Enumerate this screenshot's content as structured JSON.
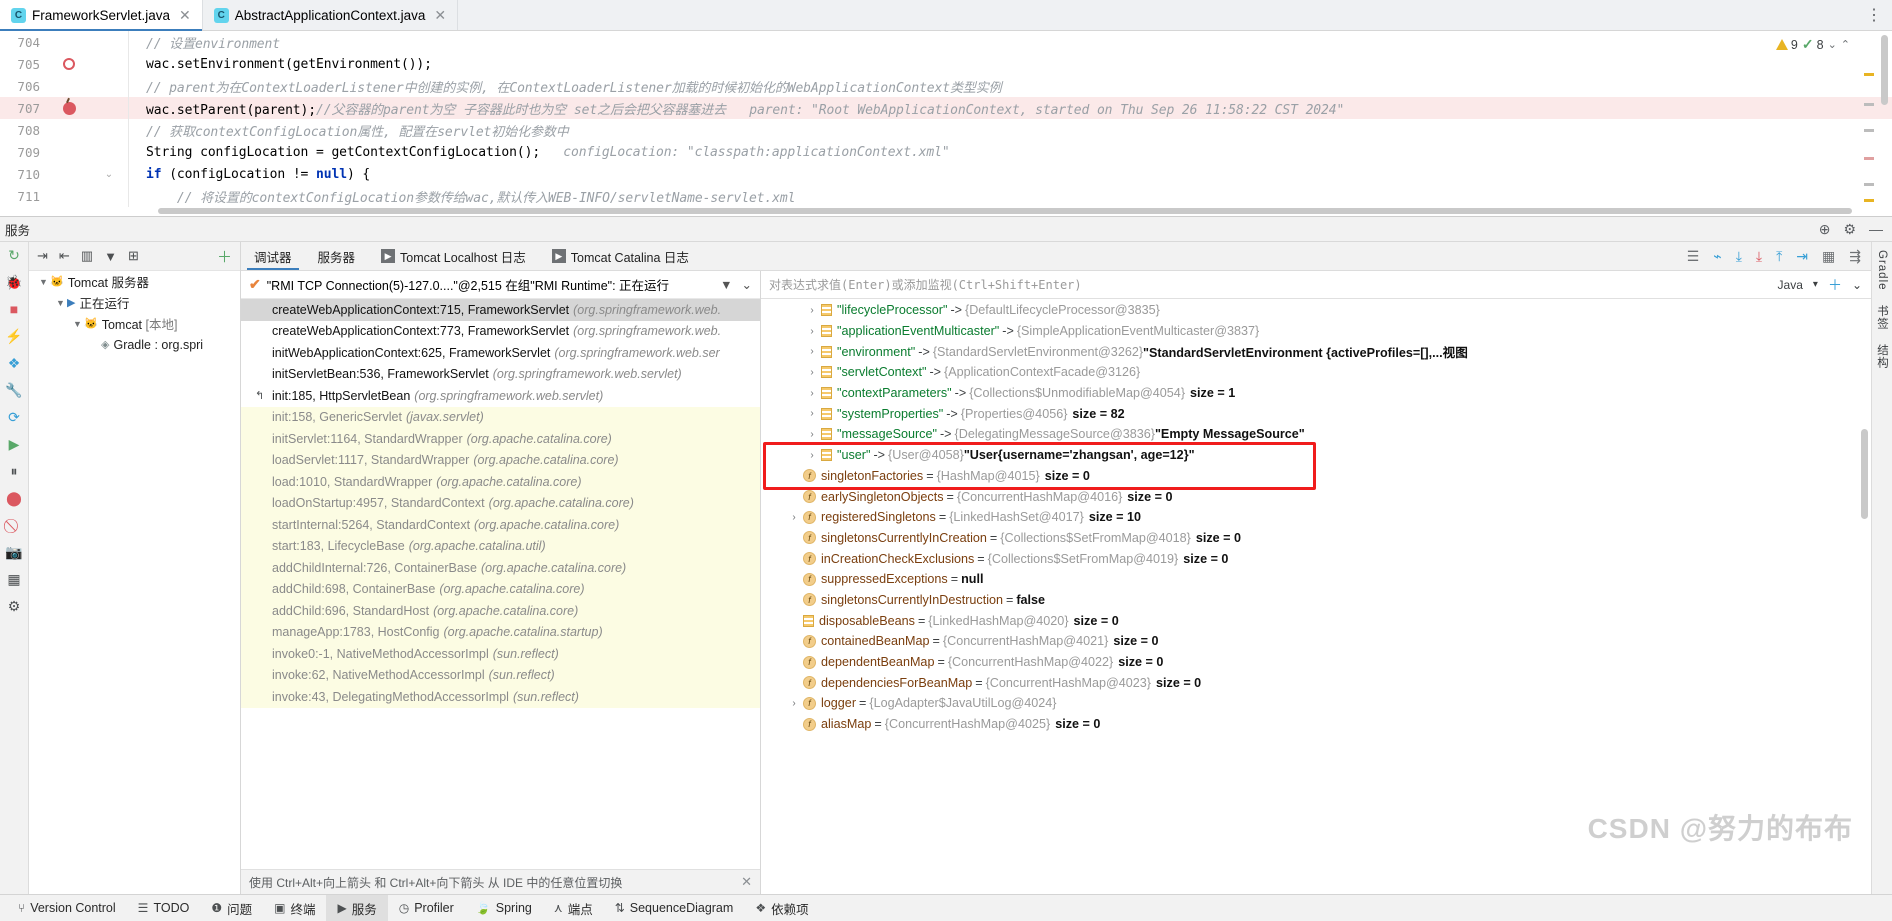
{
  "editor_tabs": [
    {
      "label": "FrameworkServlet.java",
      "icon": "java-class-icon",
      "active": true,
      "closable": true
    },
    {
      "label": "AbstractApplicationContext.java",
      "icon": "java-class-icon",
      "active": false,
      "closable": true
    }
  ],
  "editor": {
    "warnings_count": "9",
    "hints_count": "8",
    "lines": [
      {
        "num": "704",
        "marker": "",
        "fold": "",
        "highlight": false,
        "segments": [
          {
            "cls": "cm",
            "t": "// 设置environment"
          }
        ]
      },
      {
        "num": "705",
        "marker": "breakpoint-ring",
        "fold": "",
        "highlight": false,
        "segments": [
          {
            "cls": "cid",
            "t": "wac.setEnvironment(getEnvironment());"
          }
        ]
      },
      {
        "num": "706",
        "marker": "",
        "fold": "",
        "highlight": false,
        "segments": [
          {
            "cls": "cm",
            "t": "// parent为在ContextLoaderListener中创建的实例, 在ContextLoaderListener加载的时候初始化的WebApplicationContext类型实例"
          }
        ]
      },
      {
        "num": "707",
        "marker": "breakpoint-hit",
        "fold": "",
        "highlight": true,
        "segments": [
          {
            "cls": "cid",
            "t": "wac.setParent(parent);"
          },
          {
            "cls": "cm",
            "t": "//父容器的parent为空 子容器此时也为空 set之后会把父容器塞进去"
          },
          {
            "cls": "chint",
            "t": "   parent: \"Root WebApplicationContext, started on Thu Sep 26 11:58:22 CST 2024\""
          }
        ]
      },
      {
        "num": "708",
        "marker": "",
        "fold": "",
        "highlight": false,
        "segments": [
          {
            "cls": "cm",
            "t": "// 获取contextConfigLocation属性, 配置在servlet初始化参数中"
          }
        ]
      },
      {
        "num": "709",
        "marker": "",
        "fold": "",
        "highlight": false,
        "segments": [
          {
            "cls": "cid",
            "t": "String configLocation = getContextConfigLocation();"
          },
          {
            "cls": "chint",
            "t": "   configLocation: \"classpath:applicationContext.xml\""
          }
        ]
      },
      {
        "num": "710",
        "marker": "",
        "fold": "fold-collapse",
        "highlight": false,
        "segments": [
          {
            "cls": "ckw",
            "t": "if"
          },
          {
            "cls": "cid",
            "t": " (configLocation != "
          },
          {
            "cls": "ckw",
            "t": "null"
          },
          {
            "cls": "cid",
            "t": ") {"
          }
        ]
      },
      {
        "num": "711",
        "marker": "",
        "fold": "",
        "highlight": false,
        "segments": [
          {
            "cls": "cm",
            "t": "    // 将设置的contextConfigLocation参数传给wac,默认传入WEB-INFO/servletName-servlet.xml"
          }
        ]
      }
    ]
  },
  "services_panel": {
    "title": "服务"
  },
  "services_tree": {
    "nodes": [
      {
        "indent": 0,
        "twisty": "▼",
        "icon": "tomcat-icon",
        "label": "Tomcat 服务器",
        "suffix": ""
      },
      {
        "indent": 1,
        "twisty": "▼",
        "icon": "run-icon",
        "label": "正在运行",
        "suffix": ""
      },
      {
        "indent": 2,
        "twisty": "▼",
        "icon": "tomcat-icon",
        "label": "Tomcat",
        "suffix": " [本地]"
      },
      {
        "indent": 3,
        "twisty": "",
        "icon": "gradle-icon",
        "label": "Gradle : org.spri",
        "suffix": ""
      }
    ]
  },
  "debug_tabs": [
    {
      "label": "调试器",
      "icon": "",
      "active": true
    },
    {
      "label": "服务器",
      "icon": "",
      "active": false
    },
    {
      "label": "Tomcat Localhost 日志",
      "icon": "console-icon",
      "active": false
    },
    {
      "label": "Tomcat Catalina 日志",
      "icon": "console-icon",
      "active": false
    }
  ],
  "frames": {
    "thread_label": "\"RMI TCP Connection(5)-127.0....\"@2,515 在组\"RMI Runtime\": 正在运行",
    "footer_hint": "使用 Ctrl+Alt+向上箭头 和 Ctrl+Alt+向下箭头 从 IDE 中的任意位置切换",
    "rows": [
      {
        "method": "createWebApplicationContext:715, FrameworkServlet",
        "pkg": "(org.springframework.web.",
        "state": "selected",
        "mark": ""
      },
      {
        "method": "createWebApplicationContext:773, FrameworkServlet",
        "pkg": "(org.springframework.web.",
        "state": "normal",
        "mark": ""
      },
      {
        "method": "initWebApplicationContext:625, FrameworkServlet",
        "pkg": "(org.springframework.web.ser",
        "state": "normal",
        "mark": ""
      },
      {
        "method": "initServletBean:536, FrameworkServlet",
        "pkg": "(org.springframework.web.servlet)",
        "state": "normal",
        "mark": ""
      },
      {
        "method": "init:185, HttpServletBean",
        "pkg": "(org.springframework.web.servlet)",
        "state": "normal",
        "mark": "↰"
      },
      {
        "method": "init:158, GenericServlet",
        "pkg": "(javax.servlet)",
        "state": "library",
        "mark": ""
      },
      {
        "method": "initServlet:1164, StandardWrapper",
        "pkg": "(org.apache.catalina.core)",
        "state": "library",
        "mark": ""
      },
      {
        "method": "loadServlet:1117, StandardWrapper",
        "pkg": "(org.apache.catalina.core)",
        "state": "library",
        "mark": ""
      },
      {
        "method": "load:1010, StandardWrapper",
        "pkg": "(org.apache.catalina.core)",
        "state": "library",
        "mark": ""
      },
      {
        "method": "loadOnStartup:4957, StandardContext",
        "pkg": "(org.apache.catalina.core)",
        "state": "library",
        "mark": ""
      },
      {
        "method": "startInternal:5264, StandardContext",
        "pkg": "(org.apache.catalina.core)",
        "state": "library",
        "mark": ""
      },
      {
        "method": "start:183, LifecycleBase",
        "pkg": "(org.apache.catalina.util)",
        "state": "library",
        "mark": ""
      },
      {
        "method": "addChildInternal:726, ContainerBase",
        "pkg": "(org.apache.catalina.core)",
        "state": "library",
        "mark": ""
      },
      {
        "method": "addChild:698, ContainerBase",
        "pkg": "(org.apache.catalina.core)",
        "state": "library",
        "mark": ""
      },
      {
        "method": "addChild:696, StandardHost",
        "pkg": "(org.apache.catalina.core)",
        "state": "library",
        "mark": ""
      },
      {
        "method": "manageApp:1783, HostConfig",
        "pkg": "(org.apache.catalina.startup)",
        "state": "library",
        "mark": ""
      },
      {
        "method": "invoke0:-1, NativeMethodAccessorImpl",
        "pkg": "(sun.reflect)",
        "state": "library",
        "mark": ""
      },
      {
        "method": "invoke:62, NativeMethodAccessorImpl",
        "pkg": "(sun.reflect)",
        "state": "library",
        "mark": ""
      },
      {
        "method": "invoke:43, DelegatingMethodAccessorImpl",
        "pkg": "(sun.reflect)",
        "state": "library",
        "mark": ""
      }
    ]
  },
  "watch": {
    "placeholder": "对表达式求值(Enter)或添加监视(Ctrl+Shift+Enter)",
    "language": "Java"
  },
  "variables": {
    "rows": [
      {
        "indent": 2,
        "twisty": "›",
        "icon": "map-entry-icon",
        "key": "\"lifecycleProcessor\"",
        "key_kind": "string",
        "arrow": "->",
        "ref": "{DefaultLifecycleProcessor@3835}",
        "value": "",
        "size": "",
        "boxed": false
      },
      {
        "indent": 2,
        "twisty": "›",
        "icon": "map-entry-icon",
        "key": "\"applicationEventMulticaster\"",
        "key_kind": "string",
        "arrow": "->",
        "ref": "{SimpleApplicationEventMulticaster@3837}",
        "value": "",
        "size": "",
        "boxed": false
      },
      {
        "indent": 2,
        "twisty": "›",
        "icon": "map-entry-icon",
        "key": "\"environment\"",
        "key_kind": "string",
        "arrow": "->",
        "ref": "{StandardServletEnvironment@3262}",
        "value": "\"StandardServletEnvironment {activeProfiles=[],...视图",
        "size": "",
        "boxed": false
      },
      {
        "indent": 2,
        "twisty": "›",
        "icon": "map-entry-icon",
        "key": "\"servletContext\"",
        "key_kind": "string",
        "arrow": "->",
        "ref": "{ApplicationContextFacade@3126}",
        "value": "",
        "size": "",
        "boxed": false
      },
      {
        "indent": 2,
        "twisty": "›",
        "icon": "map-entry-icon",
        "key": "\"contextParameters\"",
        "key_kind": "string",
        "arrow": "->",
        "ref": "{Collections$UnmodifiableMap@4054}",
        "value": "",
        "size": "size = 1",
        "boxed": false
      },
      {
        "indent": 2,
        "twisty": "›",
        "icon": "map-entry-icon",
        "key": "\"systemProperties\"",
        "key_kind": "string",
        "arrow": "->",
        "ref": "{Properties@4056}",
        "value": "",
        "size": "size = 82",
        "boxed": false
      },
      {
        "indent": 2,
        "twisty": "›",
        "icon": "map-entry-icon",
        "key": "\"messageSource\"",
        "key_kind": "string",
        "arrow": "->",
        "ref": "{DelegatingMessageSource@3836}",
        "value": "\"Empty MessageSource\"",
        "size": "",
        "boxed": false
      },
      {
        "indent": 2,
        "twisty": "›",
        "icon": "map-entry-icon",
        "key": "\"user\"",
        "key_kind": "string",
        "arrow": "->",
        "ref": "{User@4058}",
        "value": "\"User{username='zhangsan', age=12}\"",
        "size": "",
        "boxed": true
      },
      {
        "indent": 1,
        "twisty": "",
        "icon": "field-icon",
        "key": "singletonFactories",
        "key_kind": "field",
        "arrow": "=",
        "ref": "{HashMap@4015}",
        "value": "",
        "size": "size = 0",
        "boxed": true
      },
      {
        "indent": 1,
        "twisty": "",
        "icon": "field-icon",
        "key": "earlySingletonObjects",
        "key_kind": "field",
        "arrow": "=",
        "ref": "{ConcurrentHashMap@4016}",
        "value": "",
        "size": "size = 0",
        "boxed": false
      },
      {
        "indent": 1,
        "twisty": "›",
        "icon": "field-icon",
        "key": "registeredSingletons",
        "key_kind": "field",
        "arrow": "=",
        "ref": "{LinkedHashSet@4017}",
        "value": "",
        "size": "size = 10",
        "boxed": false
      },
      {
        "indent": 1,
        "twisty": "",
        "icon": "field-icon",
        "key": "singletonsCurrentlyInCreation",
        "key_kind": "field",
        "arrow": "=",
        "ref": "{Collections$SetFromMap@4018}",
        "value": "",
        "size": "size = 0",
        "boxed": false
      },
      {
        "indent": 1,
        "twisty": "",
        "icon": "field-icon",
        "key": "inCreationCheckExclusions",
        "key_kind": "field",
        "arrow": "=",
        "ref": "{Collections$SetFromMap@4019}",
        "value": "",
        "size": "size = 0",
        "boxed": false
      },
      {
        "indent": 1,
        "twisty": "",
        "icon": "field-icon",
        "key": "suppressedExceptions",
        "key_kind": "field",
        "arrow": "=",
        "ref": "",
        "value": "null",
        "size": "",
        "boxed": false
      },
      {
        "indent": 1,
        "twisty": "",
        "icon": "field-icon",
        "key": "singletonsCurrentlyInDestruction",
        "key_kind": "field",
        "arrow": "=",
        "ref": "",
        "value": "false",
        "size": "",
        "boxed": false
      },
      {
        "indent": 1,
        "twisty": "",
        "icon": "map-entry-icon",
        "key": "disposableBeans",
        "key_kind": "field",
        "arrow": "=",
        "ref": "{LinkedHashMap@4020}",
        "value": "",
        "size": "size = 0",
        "boxed": false
      },
      {
        "indent": 1,
        "twisty": "",
        "icon": "field-icon",
        "key": "containedBeanMap",
        "key_kind": "field",
        "arrow": "=",
        "ref": "{ConcurrentHashMap@4021}",
        "value": "",
        "size": "size = 0",
        "boxed": false
      },
      {
        "indent": 1,
        "twisty": "",
        "icon": "field-icon",
        "key": "dependentBeanMap",
        "key_kind": "field",
        "arrow": "=",
        "ref": "{ConcurrentHashMap@4022}",
        "value": "",
        "size": "size = 0",
        "boxed": false
      },
      {
        "indent": 1,
        "twisty": "",
        "icon": "field-icon",
        "key": "dependenciesForBeanMap",
        "key_kind": "field",
        "arrow": "=",
        "ref": "{ConcurrentHashMap@4023}",
        "value": "",
        "size": "size = 0",
        "boxed": false
      },
      {
        "indent": 1,
        "twisty": "›",
        "icon": "field-icon",
        "key": "logger",
        "key_kind": "field",
        "arrow": "=",
        "ref": "{LogAdapter$JavaUtilLog@4024}",
        "value": "",
        "size": "",
        "boxed": false
      },
      {
        "indent": 1,
        "twisty": "",
        "icon": "field-icon",
        "key": "aliasMap",
        "key_kind": "field",
        "arrow": "=",
        "ref": "{ConcurrentHashMap@4025}",
        "value": "",
        "size": "size = 0",
        "boxed": false
      }
    ]
  },
  "watermark": "CSDN @努力的布布",
  "right_strip": {
    "labels": [
      "Gradle",
      "书签",
      "结构"
    ]
  },
  "statusbar": {
    "items": [
      {
        "label": "Version Control",
        "icon": "branch-icon",
        "active": false
      },
      {
        "label": "TODO",
        "icon": "todo-icon",
        "active": false
      },
      {
        "label": "问题",
        "icon": "problems-icon",
        "active": false
      },
      {
        "label": "终端",
        "icon": "terminal-icon",
        "active": false
      },
      {
        "label": "服务",
        "icon": "services-run-icon",
        "active": true
      },
      {
        "label": "Profiler",
        "icon": "profiler-icon",
        "active": false
      },
      {
        "label": "Spring",
        "icon": "spring-leaf-icon",
        "active": false
      },
      {
        "label": "端点",
        "icon": "endpoints-icon",
        "active": false
      },
      {
        "label": "SequenceDiagram",
        "icon": "sequence-icon",
        "active": false
      },
      {
        "label": "依赖项",
        "icon": "dependencies-icon",
        "active": false
      }
    ]
  },
  "colors": {
    "accent": "#3c7ebc",
    "highlight_box": "#f01c1c",
    "string_green": "#067d17",
    "keyword_blue": "#0033b3",
    "breakpoint_red": "#db5860"
  }
}
